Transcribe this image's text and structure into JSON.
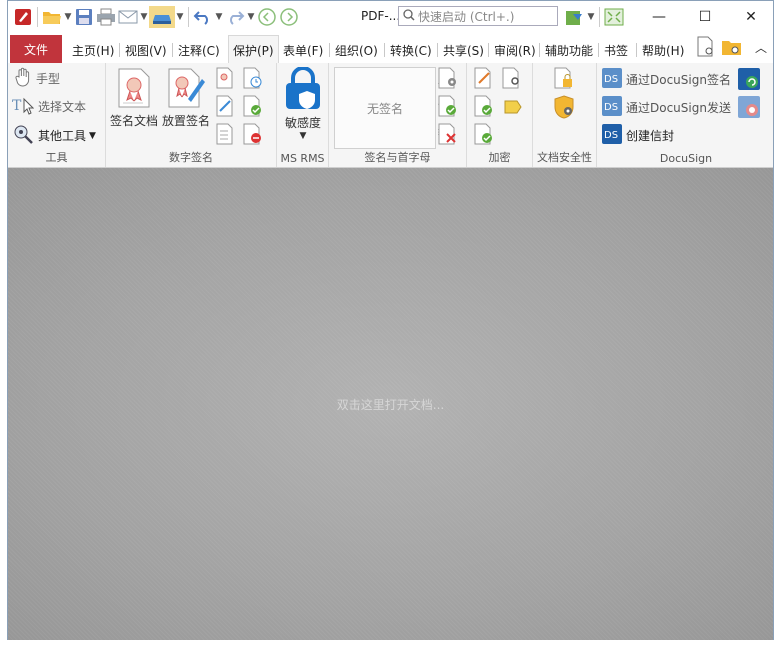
{
  "window": {
    "doc_title": "PDF-...",
    "search_placeholder": "快速启动 (Ctrl+.)",
    "controls": {
      "minimize": "—",
      "maximize": "☐",
      "close": "✕"
    }
  },
  "menu": {
    "file": "文件",
    "tabs": [
      "主页(H)",
      "视图(V)",
      "注释(C)",
      "保护(P)",
      "表单(F)",
      "组织(O)",
      "转换(C)",
      "共享(S)",
      "审阅(R)",
      "辅助功能",
      "书签",
      "帮助(H)"
    ],
    "active_tab": "保护(P)"
  },
  "ribbon": {
    "tools": {
      "label": "工具",
      "hand": "手型",
      "select_text": "选择文本",
      "other_tools": "其他工具"
    },
    "digital_signature": {
      "label": "数字签名",
      "sign_document": "签名文档",
      "place_signature": "放置签名"
    },
    "ms_rms": {
      "label": "MS RMS",
      "sensitivity": "敏感度"
    },
    "sign_initials": {
      "label": "签名与首字母",
      "no_signature": "无签名"
    },
    "encrypt": {
      "label": "加密"
    },
    "doc_security": {
      "label": "文档安全性"
    },
    "docusign": {
      "label": "DocuSign",
      "sign_via": "通过DocuSign签名",
      "send_via": "通过DocuSign发送",
      "create_envelope": "创建信封"
    }
  },
  "document_area": {
    "hint": "双击这里打开文档..."
  },
  "colors": {
    "file_tab": "#c1343c",
    "accent_blue": "#1a73c9",
    "doc_bg": "#a2a2a2"
  }
}
